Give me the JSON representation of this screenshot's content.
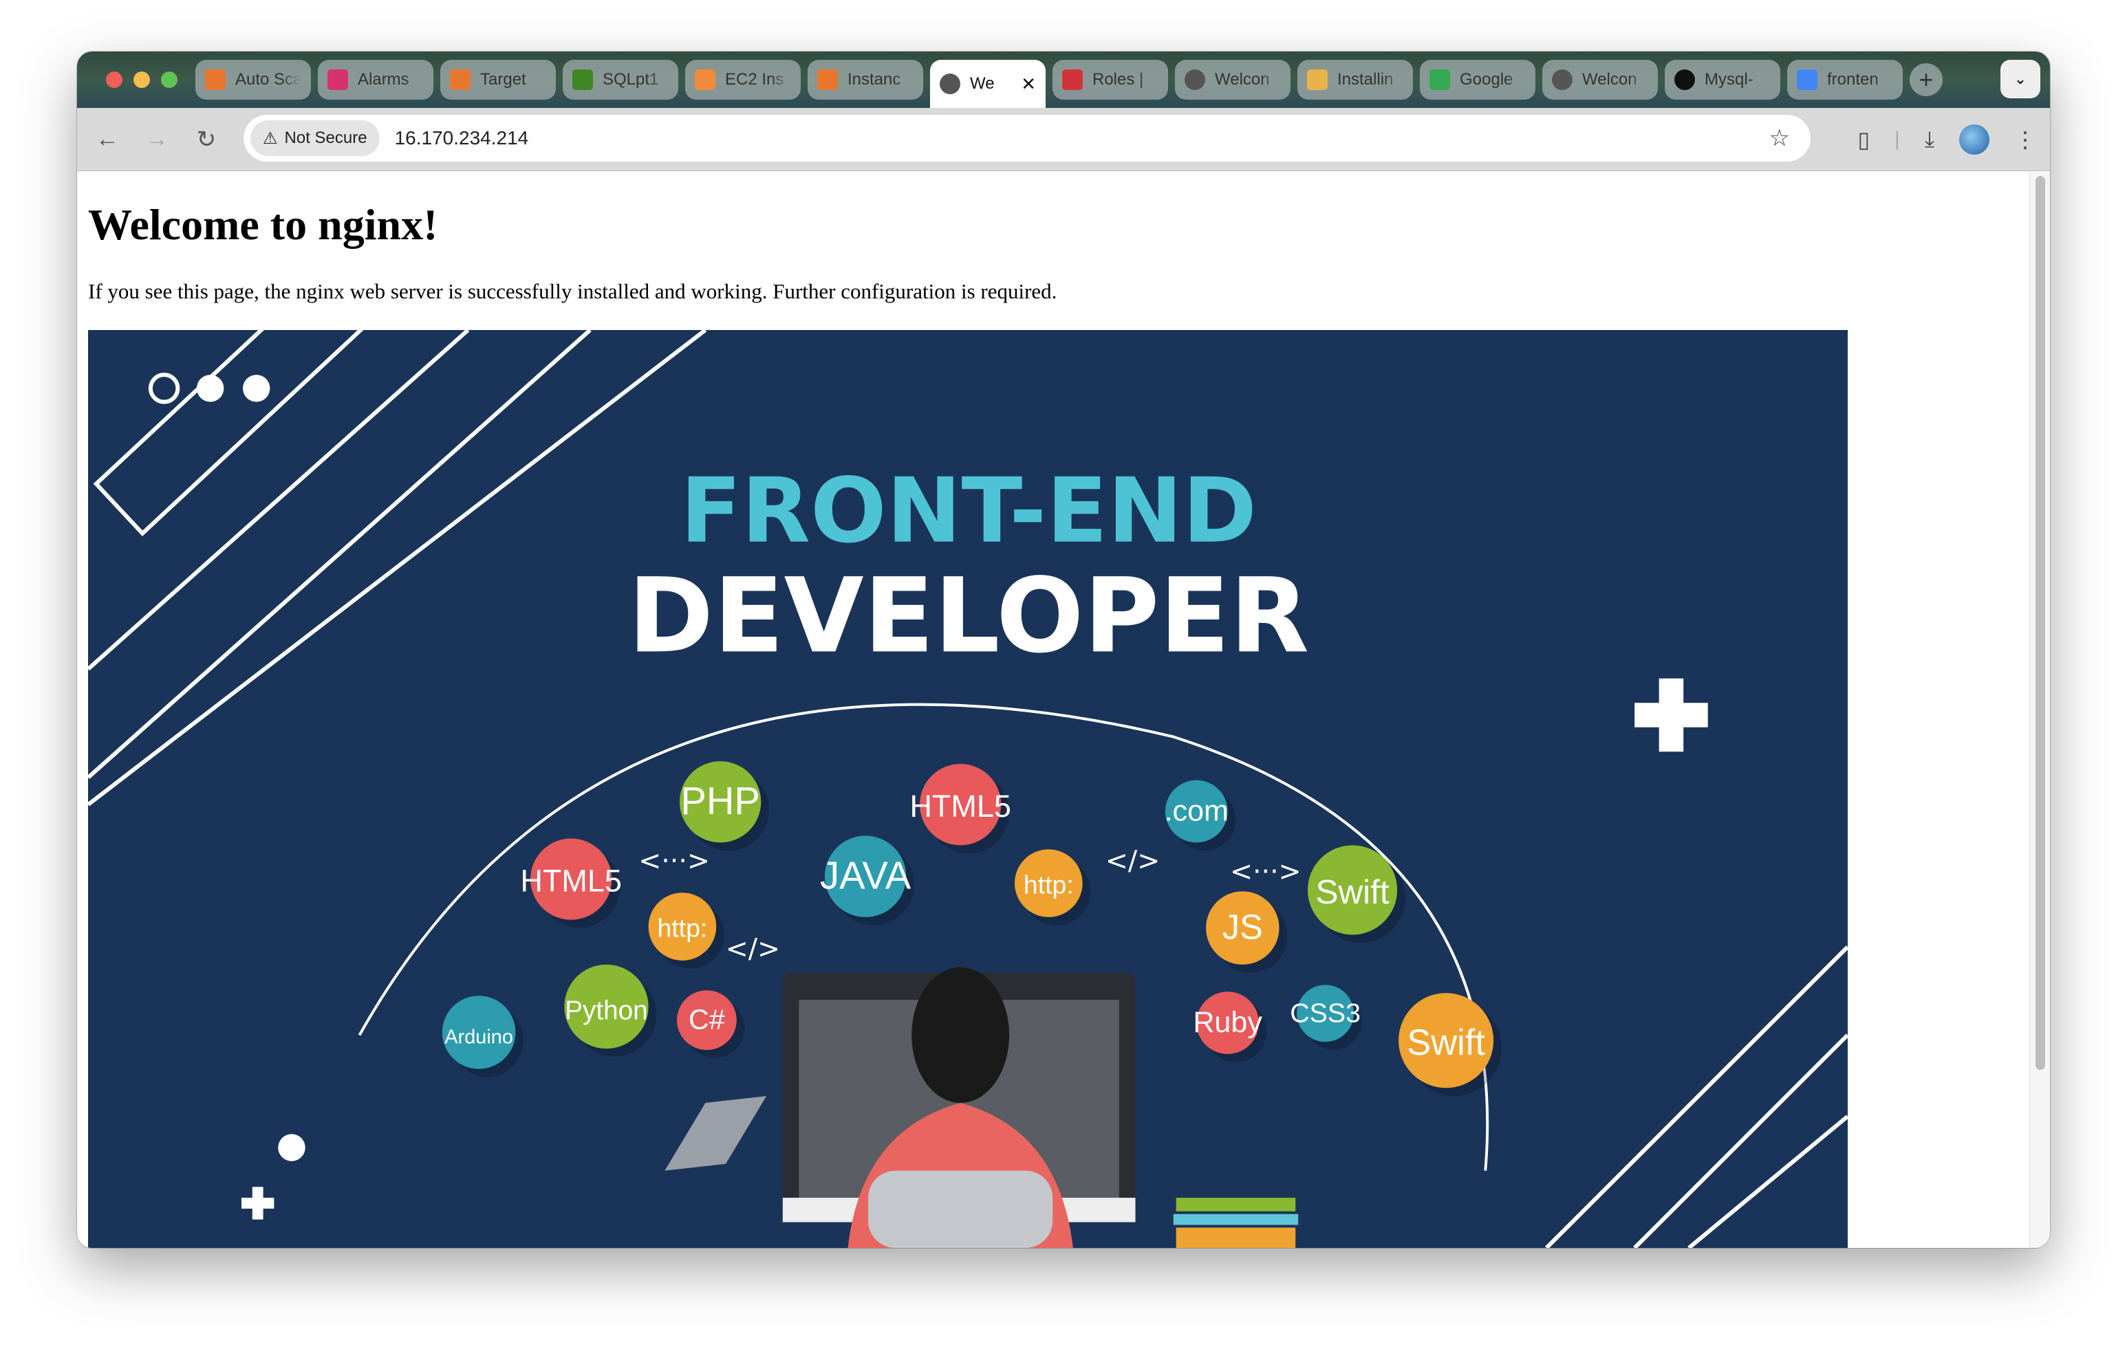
{
  "browser": {
    "tabs": [
      {
        "label": "Auto Scaling",
        "icon": "aws-icon",
        "color": "#e8762d"
      },
      {
        "label": "Alarms",
        "icon": "cloudwatch-icon",
        "color": "#d6336c"
      },
      {
        "label": "Target",
        "icon": "aws-icon",
        "color": "#e8762d"
      },
      {
        "label": "SQLpt1",
        "icon": "bucket-icon",
        "color": "#3f8624"
      },
      {
        "label": "EC2 Ins",
        "icon": "box-icon",
        "color": "#f08a3c"
      },
      {
        "label": "Instanc",
        "icon": "aws-icon",
        "color": "#e8762d"
      },
      {
        "label": "We",
        "icon": "globe-icon",
        "color": "#555555",
        "active": true
      },
      {
        "label": "Roles |",
        "icon": "iam-icon",
        "color": "#d13438"
      },
      {
        "label": "Welcon",
        "icon": "globe-icon",
        "color": "#555555"
      },
      {
        "label": "Installin",
        "icon": "doc-icon",
        "color": "#e7b34a"
      },
      {
        "label": "Google",
        "icon": "meet-icon",
        "color": "#34a853"
      },
      {
        "label": "Welcon",
        "icon": "globe-icon",
        "color": "#555555"
      },
      {
        "label": "Mysql-",
        "icon": "github-icon",
        "color": "#111111"
      },
      {
        "label": "fronten",
        "icon": "google-icon",
        "color": "#4285f4"
      }
    ],
    "security_chip": "Not Secure",
    "url": "16.170.234.214"
  },
  "page": {
    "title": "Welcome to nginx!",
    "text": "If you see this page, the nginx web server is successfully installed and working. Further configuration is required."
  },
  "hero": {
    "line1": "FRONT-END",
    "line2": "DEVELOPER",
    "line1_color": "#4fc3d6",
    "background": "#1a3459",
    "bubbles": [
      "PHP",
      "HTML5",
      "HTML5",
      "JAVA",
      "http:",
      ".com",
      "Swift",
      "http:",
      "JS",
      "Arduino",
      "Python",
      "C#",
      "Ruby",
      "CSS3",
      "Swift"
    ],
    "glyphs": [
      "<···>",
      "</>",
      "<···>",
      "</>"
    ]
  }
}
